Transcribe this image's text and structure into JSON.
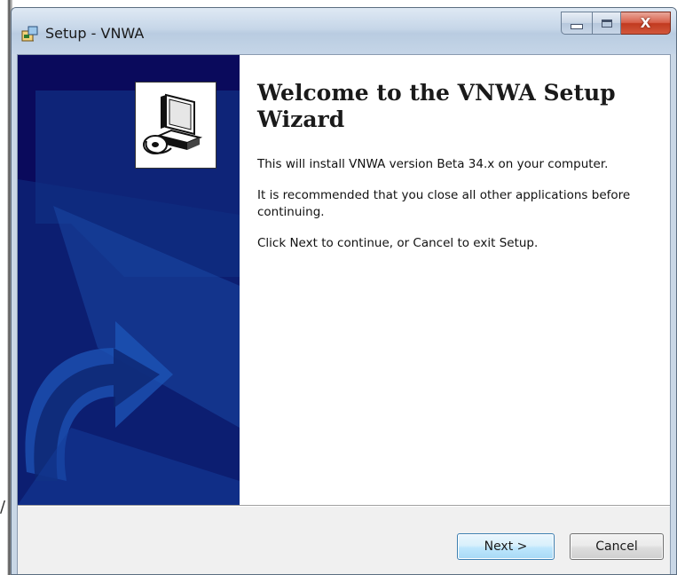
{
  "window": {
    "title": "Setup - VNWA",
    "icon": "setup-installer-icon",
    "caption_buttons": {
      "minimize_icon": "minimize-icon",
      "maximize_icon": "maximize-icon",
      "close_icon": "close-icon",
      "close_glyph": "X"
    }
  },
  "side_panel": {
    "graphic": "installer-arrow-graphic",
    "logo": "computer-setup-icon",
    "background_color": "#0a0a5c"
  },
  "wizard": {
    "heading": "Welcome to the VNWA Setup Wizard",
    "paragraphs": [
      "This will install VNWA version Beta 34.x on your computer.",
      "It is recommended that you close all other applications before continuing.",
      "Click Next to continue, or Cancel to exit Setup."
    ]
  },
  "footer": {
    "next_label": "Next >",
    "cancel_label": "Cancel"
  },
  "colors": {
    "close_button": "#c13a1f",
    "default_button_border": "#3c7fb1",
    "panel": "#0a0a5c"
  }
}
